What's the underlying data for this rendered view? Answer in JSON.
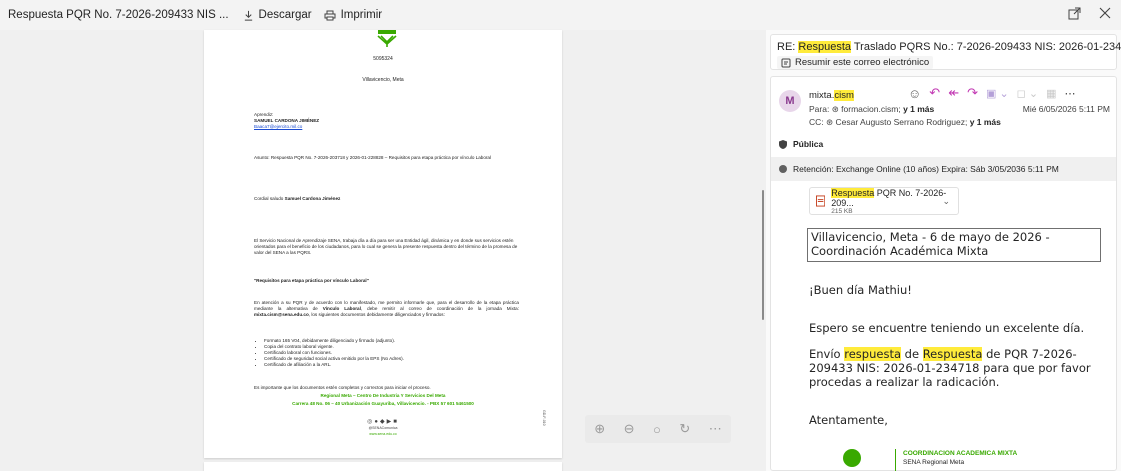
{
  "toolbar": {
    "title": "Respuesta PQR No. 7-2026-209433 NIS ...",
    "download": "Descargar",
    "print": "Imprimir"
  },
  "document": {
    "logo_text": "SENA",
    "code": "5095324",
    "city": "Villavicencio, Meta",
    "aprendiz_label": "Aprendiz:",
    "aprendiz_name": "SAMUEL CARDONA JIMÉNEZ",
    "aprendiz_email": "Baaca7@ejercito.mil.co",
    "asunto": "Asunto:  Respuesta PQR No. 7-2026-203718 y 2026-01-228828 – Requisitos para etapa práctica por vínculo Laboral",
    "saludo_prefix": "Cordial saludo ",
    "saludo_name": "Samuel Cardona Jiménez",
    "intro": "El Servicio Nacional de Aprendizaje SENA, trabaja día a día para ser una Entidad ágil, dinámica y en donde sus servicios estén orientados para el beneficio de los ciudadanos, para lo cual se genera la presente respuesta dentro del término de la promesa de valor del SENA a las PQRS.",
    "req_title": "\"Requisitos para etapa práctica por vínculo Laboral\"",
    "para1_a": "En atención a su PQR y de acuerdo con lo manifestado, me permito informarle que, para el desarrollo de la etapa práctica mediante la alternativa de ",
    "para1_b": "Vínculo Laboral",
    "para1_c": ", debe remitir al correo de coordinación de la jornada Mixta: ",
    "para1_d": "mixta.cism@sena.edu.co",
    "para1_e": ", los siguientes documentos debidamente diligenciados y firmados:",
    "list": [
      "Formato 165 V04, debidamente diligenciado y firmado (adjunto).",
      "Copia del contrato laboral vigente.",
      "Certificado laboral con funciones.",
      "Certificado de seguridad social activa emitido por la EPS (No Adres).",
      "Certificado de afiliación a la ARL."
    ],
    "closing": "Es importante que los documentos estén completos y correctos para iniciar el proceso.",
    "footer1": "Regional Meta – Centro De Industria Y Servicios Del Meta",
    "footer2": "Carrera 48 No. 06 – 40 Urbanización Guayuriba, Villavicencio. - PBX 57 601 5461500",
    "social_handle": "@SENAComunica",
    "website": "www.sena.edu.co",
    "side_code": "GD-F-010"
  },
  "mail": {
    "subject_prefix": "RE: ",
    "subject_hl": "Respuesta",
    "subject_rest": " Traslado PQRS No.: 7-2026-209433 NIS: 2026-01-234718",
    "summarize": "Resumir este correo electrónico",
    "avatar": "M",
    "from_prefix": "mixta.",
    "from_hl": "cism",
    "to_label": "Para: ",
    "to_value": "formacion.cism;",
    "to_more": "y 1 más",
    "date": "Mié 6/05/2026 5:11 PM",
    "cc_label": "CC: ",
    "cc_value": "Cesar Augusto Serrano Rodriguez;",
    "cc_more": "y 1 más",
    "sensitivity": "Pública",
    "retention": "Retención: Exchange Online (10 años) Expira: Sáb 3/05/2036 5:11 PM",
    "attachment_hl": "Respuesta",
    "attachment_rest": " PQR No. 7-2026-209...",
    "attachment_size": "215 KB",
    "body_header": "Villavicencio, Meta - 6 de mayo de 2026 - Coordinación Académica Mixta",
    "greeting": "¡Buen día Mathiu!",
    "wish": "Espero se encuentre teniendo un excelente día.",
    "send_a": "Envío ",
    "send_hl1": "respuesta",
    "send_b": " de ",
    "send_hl2": "Respuesta",
    "send_c": " de PQR  7-2026-209433 NIS: 2026-01-234718  para que por favor procedas a realizar la radicación.",
    "regards": "Atentamente,",
    "sig_title": "COORDINACION ACADEMICA MIXTA",
    "sig_sub": "SENA Regional Meta"
  },
  "colors": {
    "sena_green": "#39a900",
    "outlook_accent": "#c239b3",
    "highlight": "#ffeb3b"
  }
}
